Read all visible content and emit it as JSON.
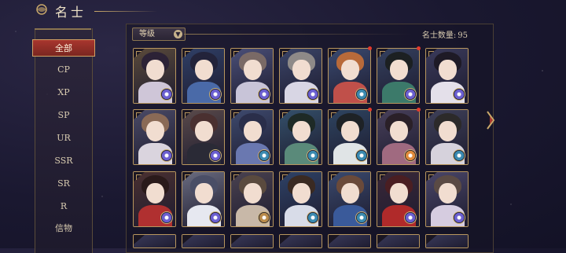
{
  "header": {
    "title": "名士"
  },
  "sidebar": {
    "items": [
      {
        "label": "全部",
        "active": true
      },
      {
        "label": "CP"
      },
      {
        "label": "XP"
      },
      {
        "label": "SP"
      },
      {
        "label": "UR"
      },
      {
        "label": "SSR"
      },
      {
        "label": "SR"
      },
      {
        "label": "R"
      },
      {
        "label": "信物"
      }
    ]
  },
  "toolbar": {
    "sort_label": "等级",
    "count_label": "名士数量:",
    "count_value": "95"
  },
  "cards": [
    {
      "bg": "#5a4a3a",
      "hair": "#2c2236",
      "body": "#cfc6d8",
      "badge": "#6b5fd0"
    },
    {
      "bg": "#2f3f66",
      "hair": "#23233a",
      "body": "#4a6aa8",
      "badge": "#6b5fd0"
    },
    {
      "bg": "#4a4f78",
      "hair": "#7a6a66",
      "body": "#c8c4d8",
      "badge": "#6b5fd0"
    },
    {
      "bg": "#3b4568",
      "hair": "#8e8a88",
      "body": "#d8d6e4",
      "badge": "#6b5fd0"
    },
    {
      "bg": "#3a4a70",
      "hair": "#b86a3a",
      "body": "#c0504a",
      "badge": "#3a8ab0",
      "dot": true
    },
    {
      "bg": "#34405e",
      "hair": "#1c2022",
      "body": "#3c7a6a",
      "badge": "#6b5fd0",
      "dot": true
    },
    {
      "bg": "#3a3a5a",
      "hair": "#1e1a26",
      "body": "#e4e0ea",
      "badge": "#6b5fd0"
    },
    {
      "bg": "#4a4a66",
      "hair": "#8a6a56",
      "body": "#dad4de",
      "badge": "#6b5fd0"
    },
    {
      "bg": "#5a4a4a",
      "hair": "#4a3030",
      "body": "#2a2a36",
      "badge": "#6b5fd0"
    },
    {
      "bg": "#3e4a6e",
      "hair": "#2a2e4a",
      "body": "#6a78b0",
      "badge": "#3a8ab0"
    },
    {
      "bg": "#34506a",
      "hair": "#1e2a26",
      "body": "#5a8a7a",
      "badge": "#3a8ab0"
    },
    {
      "bg": "#2e4460",
      "hair": "#1e2226",
      "body": "#e0e4e6",
      "badge": "#3a8ab0",
      "dot": true
    },
    {
      "bg": "#48405a",
      "hair": "#2a2028",
      "body": "#a06a80",
      "badge": "#e08a3a",
      "dot": true
    },
    {
      "bg": "#3e4058",
      "hair": "#2c2a2a",
      "body": "#d6d2dc",
      "badge": "#3a8ab0"
    },
    {
      "bg": "#4a3030",
      "hair": "#2a1a1a",
      "body": "#b03030",
      "badge": "#6b5fd0"
    },
    {
      "bg": "#6a6c80",
      "hair": "#4a4e66",
      "body": "#e6e8f0",
      "badge": "#6b5fd0"
    },
    {
      "bg": "#4a4250",
      "hair": "#5a4a3e",
      "body": "#c8b8a8",
      "badge": "#b88a4a"
    },
    {
      "bg": "#2e4266",
      "hair": "#3a2a22",
      "body": "#d8dce8",
      "badge": "#3a8ab0"
    },
    {
      "bg": "#3a4a6e",
      "hair": "#6a4a3a",
      "body": "#3a5a9a",
      "badge": "#3a8ab0"
    },
    {
      "bg": "#3a2838",
      "hair": "#4a1e22",
      "body": "#b02a2a",
      "badge": "#6b5fd0"
    },
    {
      "bg": "#4a4668",
      "hair": "#5a4a44",
      "body": "#d6cce0",
      "badge": "#6b5fd0"
    }
  ]
}
